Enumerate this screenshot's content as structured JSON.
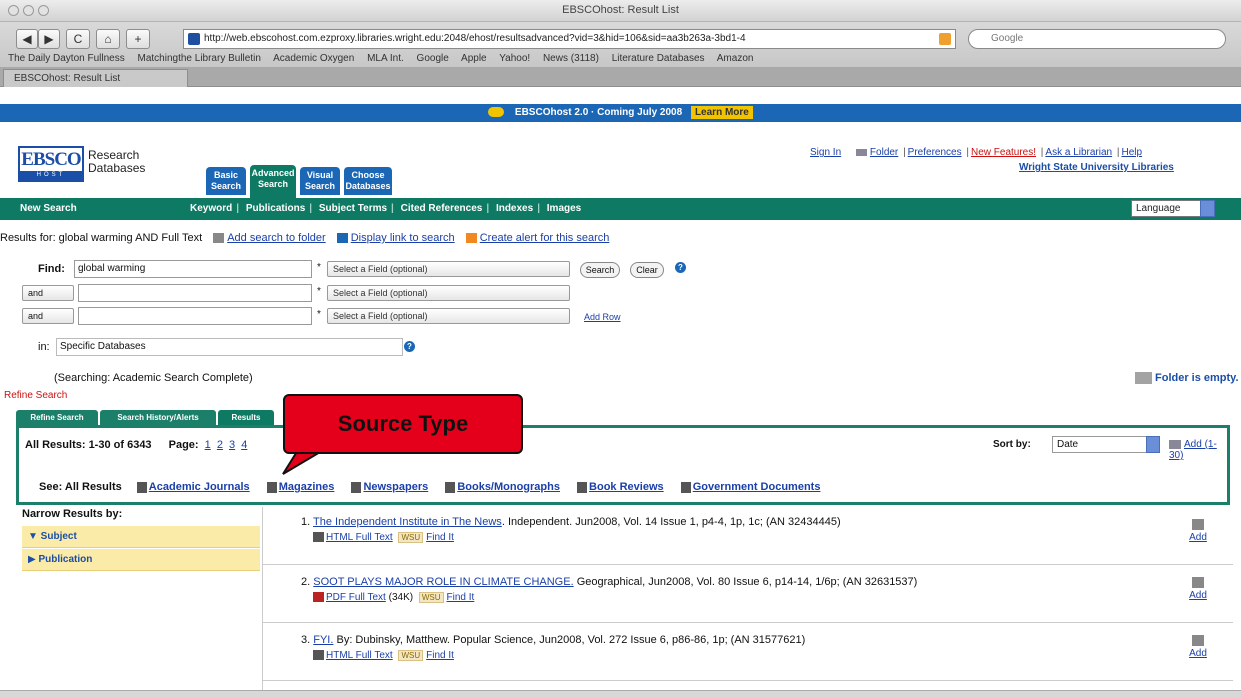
{
  "browser": {
    "window_title": "EBSCOhost: Result List",
    "url": "http://web.ebscohost.com.ezproxy.libraries.wright.edu:2048/ehost/resultsadvanced?vid=3&hid=106&sid=aa3b263a-3bd1-4",
    "search_placeholder": "Google",
    "tab_label": "EBSCOhost: Result List",
    "bookmarks": [
      "The Daily Dayton Fullness",
      "Matchingthe Library Bulletin",
      "Academic Oxygen",
      "MLA Int.",
      "Google",
      "Apple",
      "Yahoo!",
      "News (3118)",
      "Literature Databases",
      "Amazon"
    ],
    "nav_labels": {
      "back": "◀",
      "forward": "▶",
      "reload": "C",
      "home": "⌂",
      "add": "+"
    }
  },
  "announcement": {
    "text": "EBSCOhost 2.0 · Coming July 2008",
    "link": "Learn More"
  },
  "logo": {
    "main": "EBSCO",
    "sub": "HOST",
    "brand_line1": "Research",
    "brand_line2": "Databases"
  },
  "db_tabs": [
    {
      "line1": "Basic",
      "line2": "Search"
    },
    {
      "line1": "Advanced",
      "line2": "Search"
    },
    {
      "line1": "Visual",
      "line2": "Search"
    },
    {
      "line1": "Choose",
      "line2": "Databases"
    }
  ],
  "top_links": {
    "sign_in": "Sign In",
    "folder": "Folder",
    "preferences": "Preferences",
    "new_features": "New Features!",
    "ask_librarian": "Ask a Librarian",
    "help": "Help",
    "institution": "Wright State University Libraries"
  },
  "navbar": {
    "new_search": "New Search",
    "items": [
      "Keyword",
      "Publications",
      "Subject Terms",
      "Cited References",
      "Indexes",
      "Images"
    ],
    "language": "Language"
  },
  "search_form": {
    "results_for": "Results for: global warming AND Full Text",
    "add_to_folder": "Add search to folder",
    "display_link": "Display link to search",
    "create_alert": "Create alert for this search",
    "find_label": "Find:",
    "find_value": "global warming",
    "field_placeholder": "Select a Field (optional)",
    "bool_and": "and",
    "add_row": "Add Row",
    "search_button": "Search",
    "clear_button": "Clear",
    "in_label": "in:",
    "in_value": "Specific Databases",
    "searching": "(Searching: Academic Search Complete)",
    "folder_empty": "Folder is empty.",
    "filters": "Refine Search"
  },
  "sub_tabs": [
    "Refine Search",
    "Search History/Alerts",
    "Results"
  ],
  "results_header": {
    "all_results": "All Results: 1-30 of 6343",
    "page_label": "Page:",
    "pages": [
      "1",
      "2",
      "3",
      "4"
    ],
    "sort_label": "Sort by:",
    "sort_value": "Date",
    "add_label": "Add (1-30)"
  },
  "source_types": {
    "see_all": "See: All Results",
    "items": [
      "Academic Journals",
      "Magazines",
      "Newspapers",
      "Books/Monographs",
      "Book Reviews",
      "Government Documents"
    ]
  },
  "callout": {
    "text": "Source Type"
  },
  "narrow": {
    "title": "Narrow Results by:",
    "facets": [
      "▼ Subject",
      "▶ Publication"
    ]
  },
  "records": [
    {
      "number": "1.",
      "title": "The Independent Institute in The News",
      "citation": "Independent. Jun2008, Vol. 14 Issue 1, p4-4, 1p, 1c; (AN 32434445)",
      "link1": "HTML Full Text",
      "findit": "Find It",
      "add": "Add"
    },
    {
      "number": "2.",
      "title": "SOOT PLAYS MAJOR ROLE IN CLIMATE CHANGE.",
      "citation": "Geographical, Jun2008, Vol. 80 Issue 6, p14-14, 1/6p; (AN 32631537)",
      "link1": "PDF Full Text",
      "link1_size": "(34K)",
      "findit": "Find It",
      "add": "Add"
    },
    {
      "number": "3.",
      "title": "FYI.",
      "citation": "By: Dubinsky, Matthew. Popular Science, Jun2008, Vol. 272 Issue 6, p86-86, 1p; (AN 31577621)",
      "link1": "HTML Full Text",
      "findit": "Find It",
      "add": "Add"
    }
  ]
}
